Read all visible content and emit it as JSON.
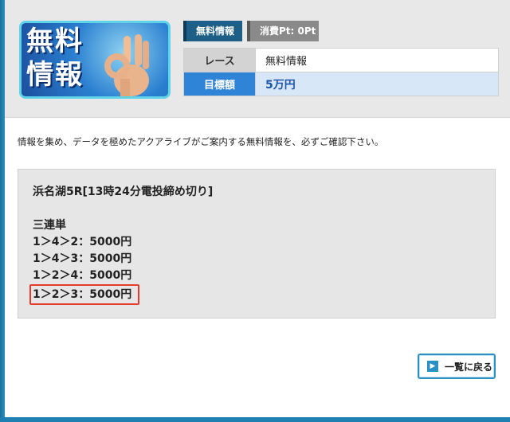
{
  "banner": {
    "line1": "無料",
    "line2": "情報",
    "hand_icon": "ok-hand-icon"
  },
  "tabs": {
    "free_info": "無料情報",
    "points": "消費Pt: 0Pt"
  },
  "info_table": {
    "race_label": "レース",
    "race_value": "無料情報",
    "target_label": "目標額",
    "target_value": "5万円"
  },
  "intro_text": "情報を集め、データを極めたアクアライブがご案内する無料情報を、必ずご確認下さい。",
  "prediction": {
    "race_title": "浜名湖5R[13時24分電投締め切り]",
    "bet_type": "三連単",
    "lines": [
      "1＞4＞2：5000円",
      "1＞4＞3：5000円",
      "1＞2＞4：5000円",
      "1＞2＞3：5000円"
    ],
    "highlighted_index": 3
  },
  "back_button": {
    "label": "一覧に戻る",
    "icon": "arrow-right-icon"
  },
  "colors": {
    "accent_blue": "#2f84d8",
    "highlight_red": "#e53b2c",
    "tab_dark": "#1d5f86"
  }
}
